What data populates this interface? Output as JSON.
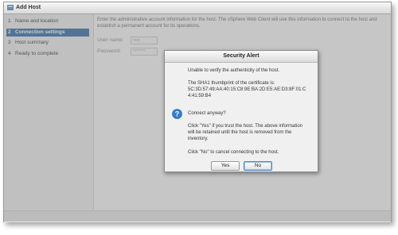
{
  "window": {
    "title": "Add Host",
    "icon": "add-host-icon"
  },
  "steps": [
    {
      "num": "1",
      "label": "Name and location"
    },
    {
      "num": "2",
      "label": "Connection settings"
    },
    {
      "num": "3",
      "label": "Host summary"
    },
    {
      "num": "4",
      "label": "Ready to complete"
    }
  ],
  "content": {
    "description": "Enter the administrative account information for the host. The vSphere Web Client will use this information to connect to the host and establish a permanent account for its operations.",
    "username_label": "User name:",
    "username_value": "root",
    "password_label": "Password:",
    "password_value": "********"
  },
  "dialog": {
    "title": "Security Alert",
    "line1": "Unable to verify the authenticity of the host.",
    "line2": "The SHA1 thumbprint of the certificate is:",
    "thumbprint_a": "5C:3D:57:49:AA:40:15:C8:9E:BA:2D:E5:AE:D3:8F:01:C",
    "thumbprint_b": "4:41:59:B4",
    "question": "Connect anyway?",
    "yes_info_1": "Click \"Yes\" if you trust the host. The above information",
    "yes_info_2": "will be retained until the host is removed from the",
    "yes_info_3": "inventory.",
    "no_info": "Click \"No\" to cancel connecting to the host.",
    "yes_label": "Yes",
    "no_label": "No",
    "icon": "question-icon"
  },
  "colors": {
    "accent": "#2f6aa6",
    "dialog_bg": "#f0f0f0",
    "question_icon": "#2f7fd1"
  }
}
